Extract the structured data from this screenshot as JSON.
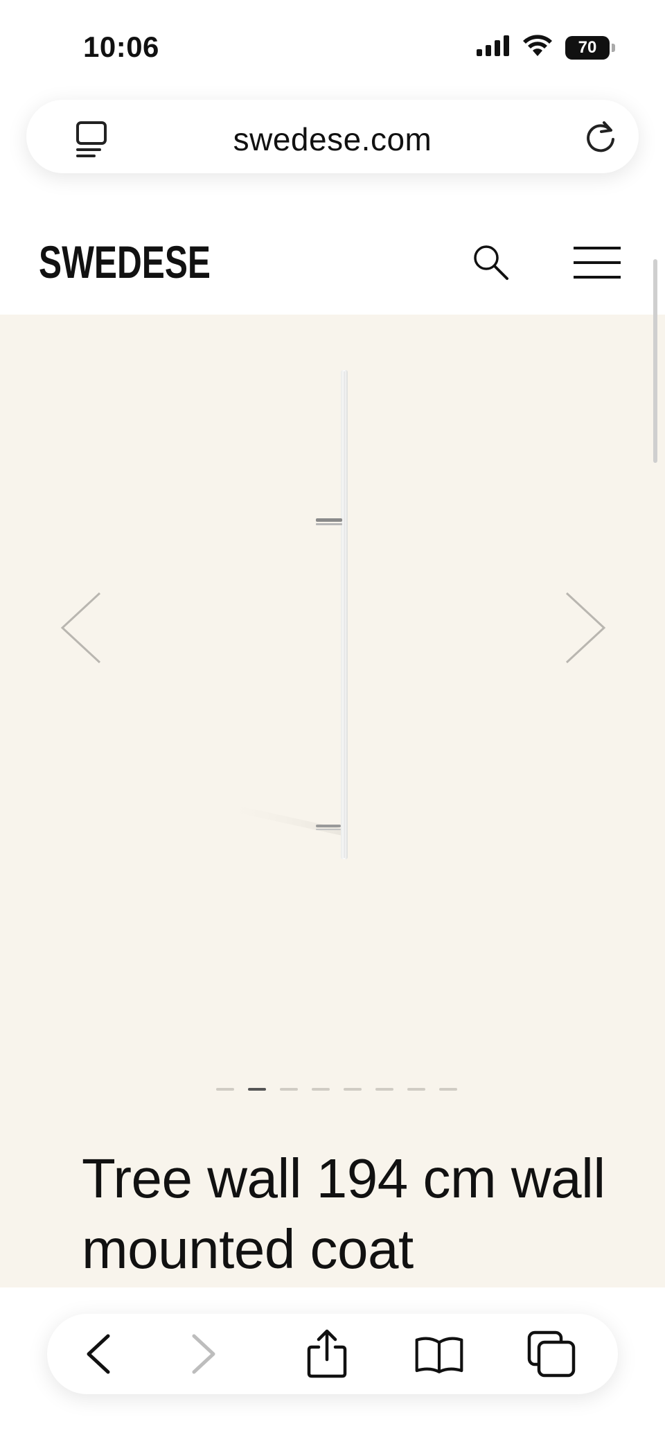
{
  "status_bar": {
    "time": "10:06",
    "battery": "70",
    "icons": [
      "signal-icon",
      "wifi-icon",
      "battery-icon"
    ]
  },
  "browser": {
    "url": "swedese.com",
    "icons": [
      "reader-mode-icon",
      "reload-icon"
    ]
  },
  "header": {
    "logo_text": "SWEDESE",
    "icons": [
      "search-icon",
      "menu-icon"
    ]
  },
  "gallery": {
    "background": "#f8f4ec",
    "slide_count": 8,
    "active_slide": 2,
    "icons": [
      "chevron-left-icon",
      "chevron-right-icon"
    ]
  },
  "product": {
    "title": "Tree wall 194 cm wall mounted coat"
  },
  "toolbar": {
    "icons": [
      "back-icon",
      "forward-icon",
      "share-icon",
      "bookmarks-icon",
      "tabs-icon"
    ]
  }
}
